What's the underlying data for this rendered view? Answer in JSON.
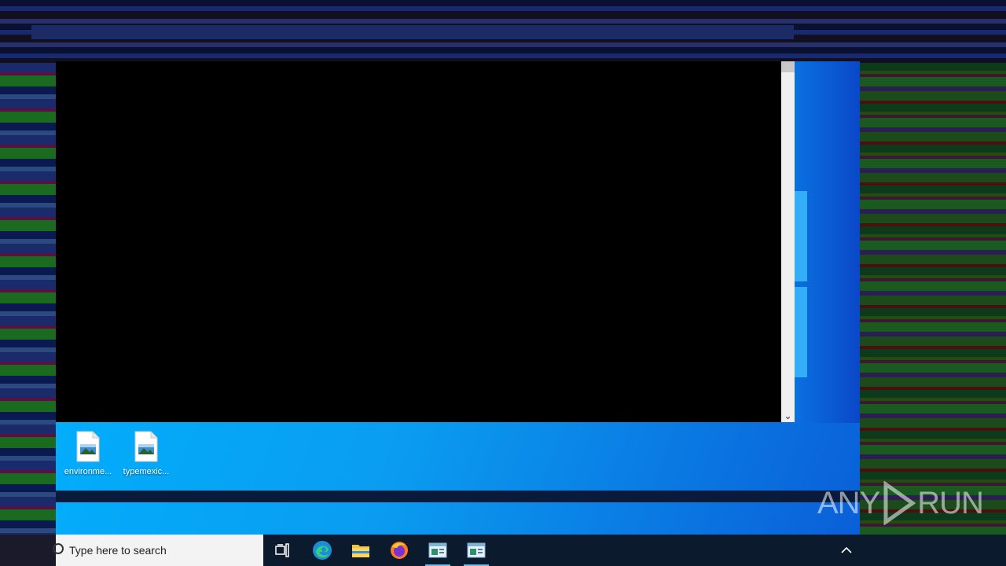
{
  "desktop": {
    "icons": [
      {
        "label": "environme...",
        "icon": "image-file-icon"
      },
      {
        "label": "typemexic...",
        "icon": "image-file-icon"
      }
    ]
  },
  "taskbar": {
    "search_placeholder": "Type here to search",
    "buttons": [
      {
        "name": "task-view",
        "icon": "task-view-icon"
      },
      {
        "name": "edge",
        "icon": "edge-icon"
      },
      {
        "name": "file-explorer",
        "icon": "folder-icon"
      },
      {
        "name": "firefox",
        "icon": "firefox-icon"
      },
      {
        "name": "app-window-1",
        "icon": "window-app-icon",
        "active": true
      },
      {
        "name": "app-window-2",
        "icon": "window-app-icon",
        "active": true
      }
    ],
    "tray_chevron": "^"
  },
  "watermark": {
    "left": "ANY",
    "right": "RUN"
  },
  "colors": {
    "desktop_accent": "#00b4ff",
    "taskbar": "#0b1a2c",
    "active_indicator": "#76b9ed"
  }
}
